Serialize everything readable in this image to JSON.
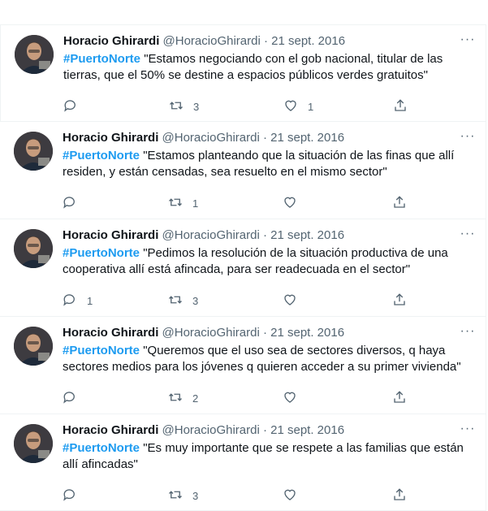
{
  "author": {
    "name": "Horacio Ghirardi",
    "handle": "@HoracioGhirardi",
    "separator": "·"
  },
  "more_label": "···",
  "tweets": [
    {
      "date": "21 sept. 2016",
      "hashtag": "#PuertoNorte",
      "text": "  \"Estamos negociando con el gob nacional, titular de las tierras, que el 50% se destine a espacios públicos verdes gratuitos\"",
      "replies": "",
      "retweets": "3",
      "likes": "1"
    },
    {
      "date": "21 sept. 2016",
      "hashtag": "#PuertoNorte",
      "text": " \"Estamos planteando que la situación de las finas que allí residen, y están censadas, sea resuelto en el mismo sector\"",
      "replies": "",
      "retweets": "1",
      "likes": ""
    },
    {
      "date": "21 sept. 2016",
      "hashtag": "#PuertoNorte",
      "text": " \"Pedimos la resolución de la situación productiva de una cooperativa allí está afincada, para ser readecuada en el sector\"",
      "replies": "1",
      "retweets": "3",
      "likes": ""
    },
    {
      "date": "21 sept. 2016",
      "hashtag": "#PuertoNorte",
      "text": " \"Queremos que el uso sea de sectores diversos, q haya sectores medios para los jóvenes q quieren acceder a su primer vivienda\"",
      "replies": "",
      "retweets": "2",
      "likes": ""
    },
    {
      "date": "21 sept. 2016",
      "hashtag": "#PuertoNorte",
      "text": " \"Es muy importante que se respete a las familias que están allí afincadas\"",
      "replies": "",
      "retweets": "3",
      "likes": ""
    }
  ],
  "icons": {
    "reply": "reply-icon",
    "retweet": "retweet-icon",
    "like": "heart-icon",
    "share": "share-icon",
    "more": "more-icon"
  },
  "colors": {
    "link": "#1d9bf0",
    "secondary": "#536471",
    "border": "#eff3f4"
  }
}
